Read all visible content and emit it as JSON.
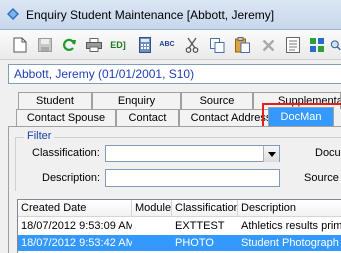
{
  "window": {
    "title": "Enquiry Student Maintenance  [Abbott, Jeremy]"
  },
  "toolbar": {
    "items": [
      {
        "name": "new-document-icon"
      },
      {
        "name": "save-icon"
      },
      {
        "name": "refresh-icon"
      },
      {
        "name": "print-icon"
      },
      {
        "name": "ed-icon",
        "label": "ED]"
      },
      {
        "name": "calculator-icon"
      },
      {
        "name": "spellcheck-icon",
        "label": "ABC"
      },
      {
        "name": "cut-icon"
      },
      {
        "name": "copy-icon"
      },
      {
        "name": "paste-icon"
      },
      {
        "name": "delete-icon"
      },
      {
        "name": "report-icon"
      },
      {
        "name": "grid-icon"
      },
      {
        "name": "zoom-icon"
      }
    ]
  },
  "record_header": "Abbott, Jeremy (01/01/2001, S10)",
  "tabs": {
    "row1": [
      "Student",
      "Enquiry",
      "Source",
      "Supplemental"
    ],
    "row2": [
      "Contact Spouse",
      "Contact",
      "Contact Address",
      "DocMan"
    ],
    "selected": "DocMan"
  },
  "filter": {
    "legend": "Filter",
    "classification_label": "Classification:",
    "classification_value": "",
    "description_label": "Description:",
    "description_value": "",
    "right_label_1": "Docu",
    "right_label_2": "Source I"
  },
  "grid": {
    "columns": [
      "Created Date",
      "Module",
      "Classification",
      "Description"
    ],
    "rows": [
      {
        "created": "18/07/2012 9:53:09 AM",
        "module": "",
        "classification": "EXTTEST",
        "description": "Athletics results prima"
      },
      {
        "created": "18/07/2012 9:53:42 AM",
        "module": "",
        "classification": "PHOTO",
        "description": "Student Photograph"
      }
    ],
    "selected_row": 1
  },
  "colors": {
    "selection": "#3399ff",
    "highlight_box": "#e81c1c",
    "header_text": "#1f3fb8",
    "legend_text": "#1a3fa8"
  }
}
